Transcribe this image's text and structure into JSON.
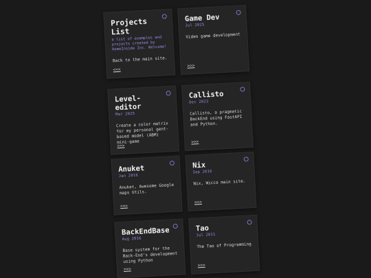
{
  "intro": {
    "title": "Projects List",
    "tagline": "a list of examples and projects created by HomeInside Inc. Welcome!",
    "back_text": "Back to the main site.",
    "back_link": "<<<"
  },
  "colors": {
    "background": "#1a1a1a",
    "card": "#252525",
    "accent": "#9a8ee8",
    "ring": "#7b76c4"
  },
  "projects": [
    {
      "title": "Game Dev",
      "date": "Jul 2025",
      "desc": "Video game development",
      "link": ">>>"
    },
    {
      "title": "Level-editor",
      "date": "Mar 2025",
      "desc": "Create a color matrix for my personal gent-based model (ABM) mini-game",
      "link": ">>>"
    },
    {
      "title": "Callisto",
      "date": "Dec 2023",
      "desc": "Callisto, a pragmatic BackEnd using FastAPI and Python.",
      "link": ">>>"
    },
    {
      "title": "Anuket",
      "date": "Jan 2016",
      "desc": "Anuket, Awesome Google maps Utils.",
      "link": ">>>"
    },
    {
      "title": "Nix",
      "date": "Sep 2016",
      "desc": "Nix, Wicca main site.",
      "link": ">>>"
    },
    {
      "title": "BackEndBase",
      "date": "Aug 2016",
      "desc": "Base system for the Back-End's development using Python",
      "link": ">>>"
    },
    {
      "title": "Tao",
      "date": "Jul 2011",
      "desc": "The Tao of Programming",
      "link": ">>>"
    }
  ]
}
